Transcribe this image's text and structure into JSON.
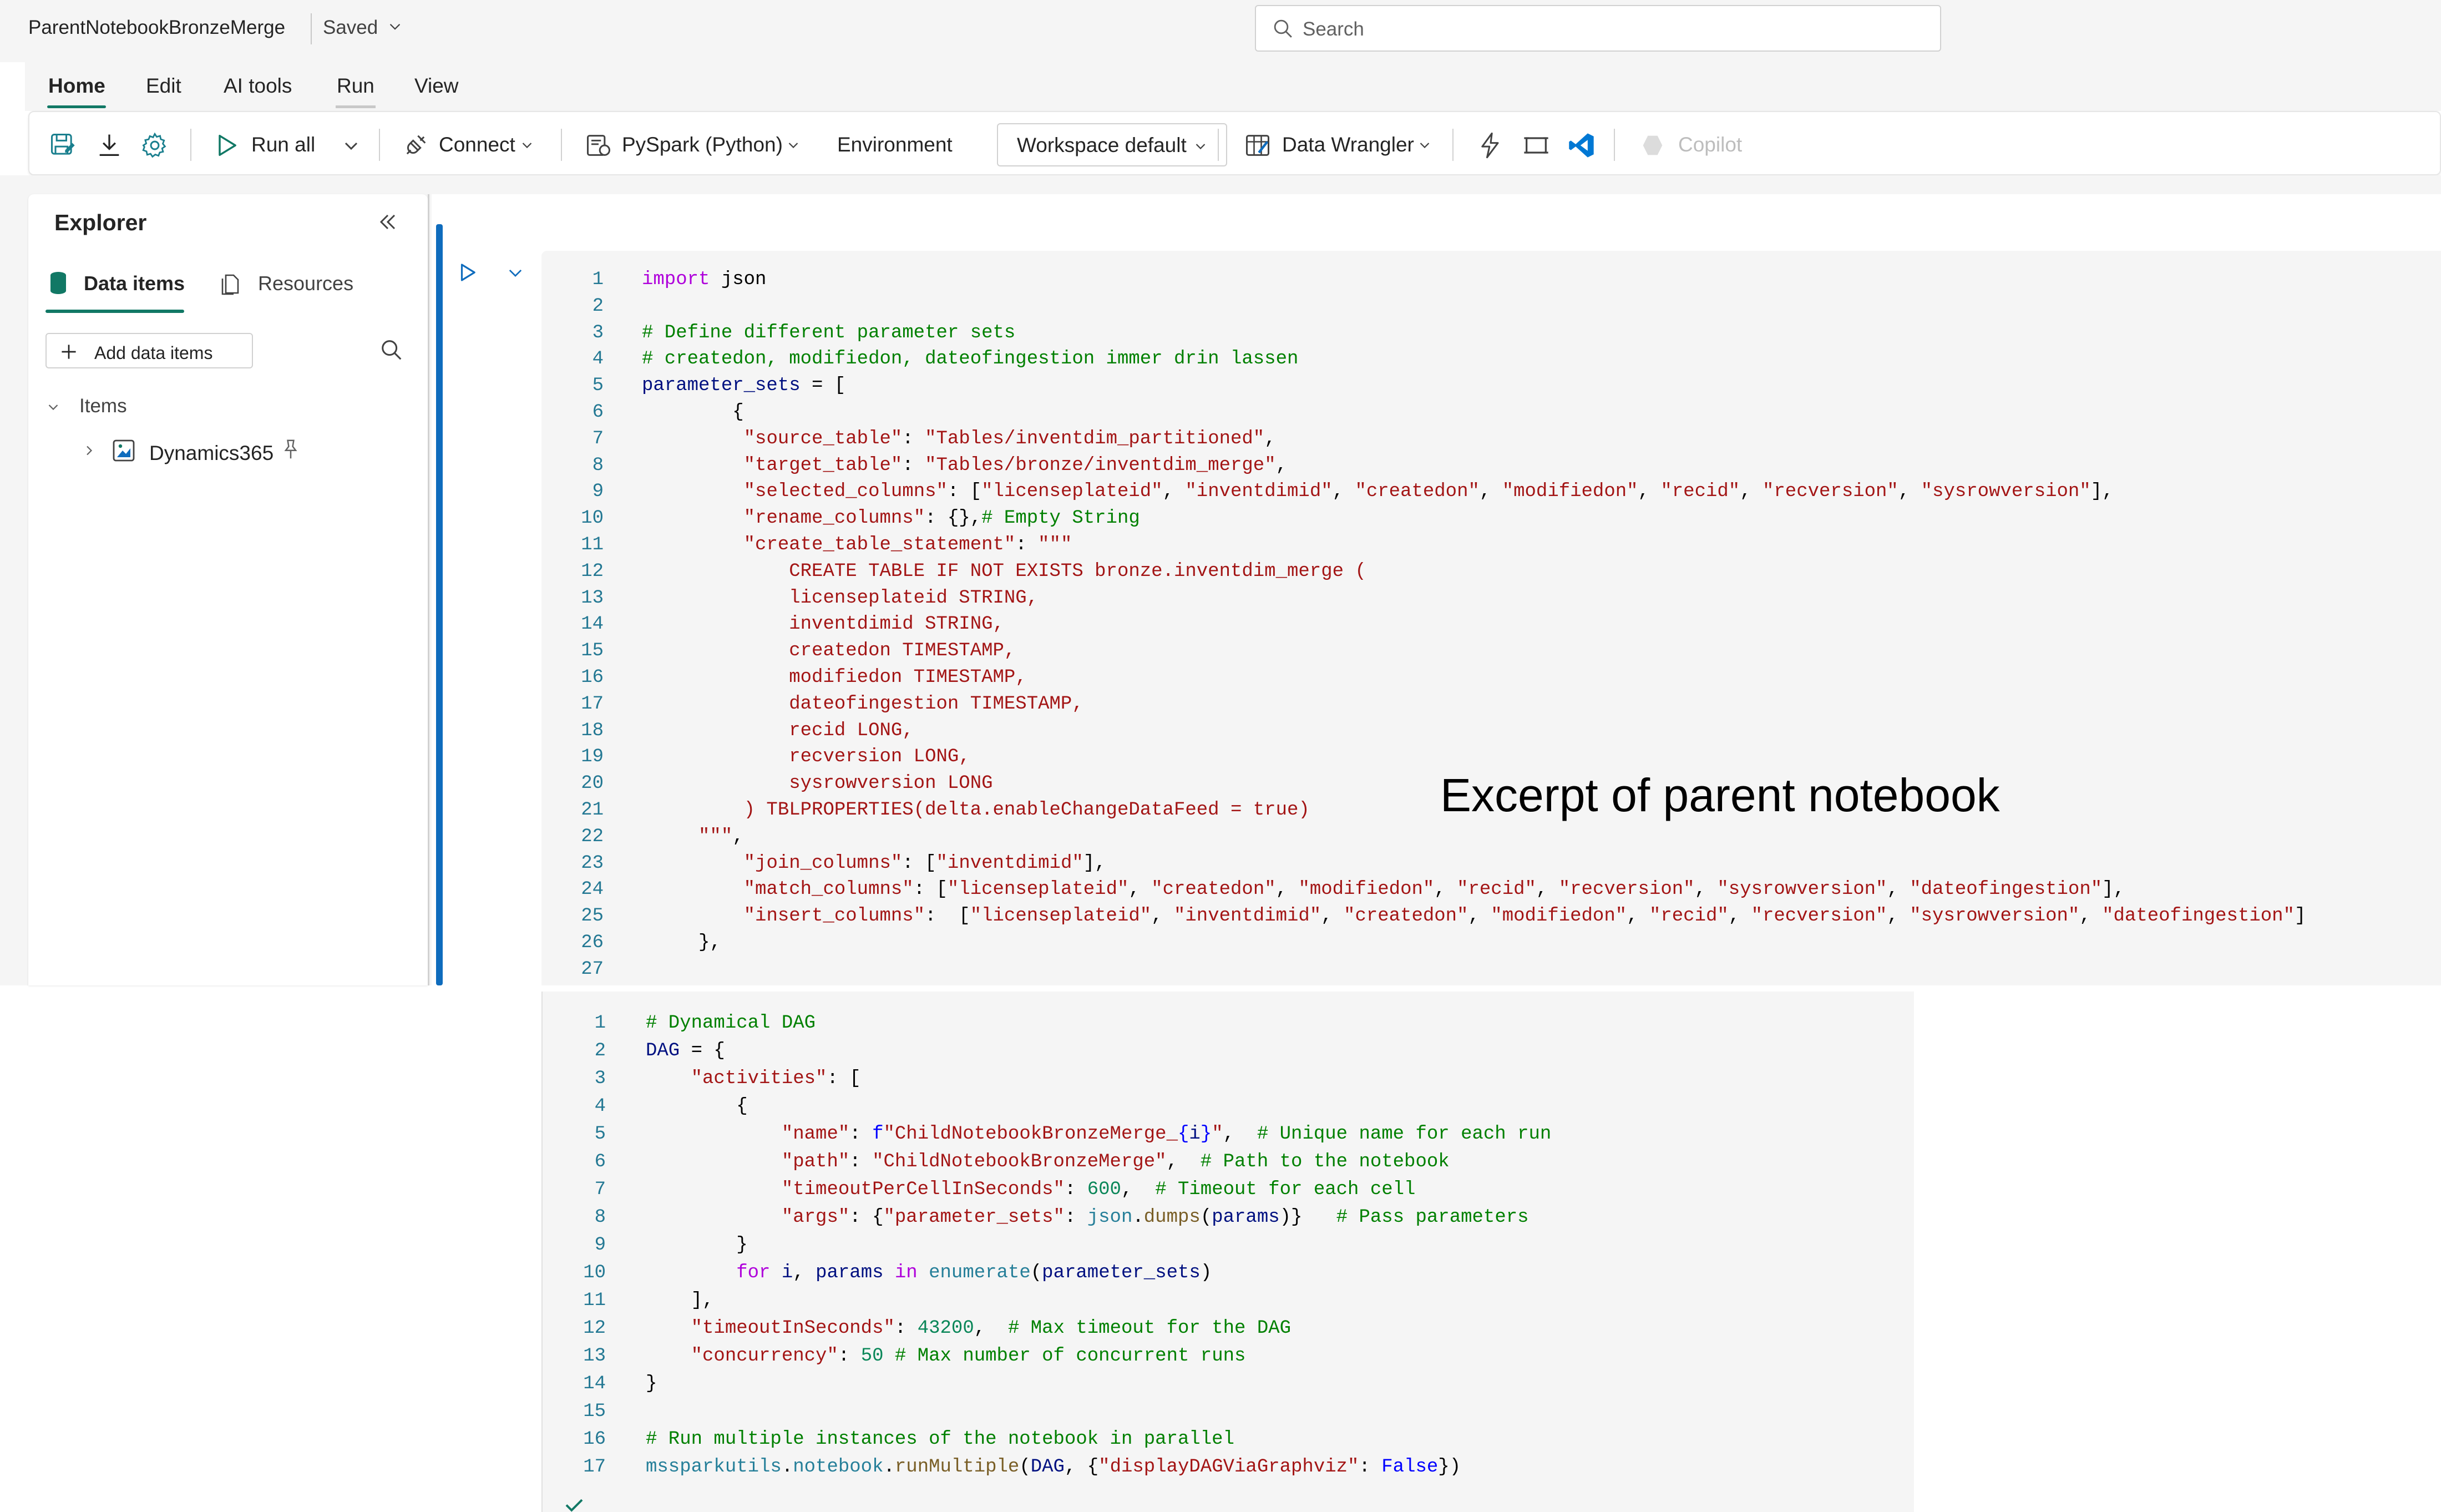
{
  "titlebar": {
    "notebook_name": "ParentNotebookBronzeMerge",
    "save_status": "Saved",
    "search_placeholder": "Search"
  },
  "menu": {
    "tabs": [
      {
        "label": "Home",
        "active": true
      },
      {
        "label": "Edit"
      },
      {
        "label": "AI tools"
      },
      {
        "label": "Run"
      },
      {
        "label": "View"
      }
    ]
  },
  "ribbon": {
    "run_all": "Run all",
    "connect": "Connect",
    "language": "PySpark (Python)",
    "environment_label": "Environment",
    "environment_value": "Workspace default",
    "data_wrangler": "Data Wrangler",
    "copilot": "Copilot"
  },
  "explorer": {
    "title": "Explorer",
    "tabs": [
      "Data items",
      "Resources"
    ],
    "add_button": "Add data items",
    "section": "Items",
    "items": [
      "Dynamics365"
    ]
  },
  "caption": "Excerpt of parent notebook",
  "colors": {
    "accent": "#117865",
    "cell_bar": "#0f6cbd",
    "keyword": "#af00db",
    "comment": "#008000",
    "string": "#a31515",
    "number": "#098658",
    "line_number": "#237893"
  },
  "cell1_code": [
    [
      [
        "kw",
        "import"
      ],
      [
        "tx",
        " json"
      ]
    ],
    [],
    [
      [
        "cm",
        "# Define different parameter sets"
      ]
    ],
    [
      [
        "cm",
        "# createdon, modifiedon, dateofingestion immer drin lassen"
      ]
    ],
    [
      [
        "va",
        "parameter_sets"
      ],
      [
        "tx",
        " = ["
      ]
    ],
    [
      [
        "tx",
        "        {"
      ]
    ],
    [
      [
        "tx",
        "         "
      ],
      [
        "st",
        "\"source_table\""
      ],
      [
        "tx",
        ": "
      ],
      [
        "st",
        "\"Tables/inventdim_partitioned\""
      ],
      [
        "tx",
        ","
      ]
    ],
    [
      [
        "tx",
        "         "
      ],
      [
        "st",
        "\"target_table\""
      ],
      [
        "tx",
        ": "
      ],
      [
        "st",
        "\"Tables/bronze/inventdim_merge\""
      ],
      [
        "tx",
        ","
      ]
    ],
    [
      [
        "tx",
        "         "
      ],
      [
        "st",
        "\"selected_columns\""
      ],
      [
        "tx",
        ": ["
      ],
      [
        "st",
        "\"licenseplateid\""
      ],
      [
        "tx",
        ", "
      ],
      [
        "st",
        "\"inventdimid\""
      ],
      [
        "tx",
        ", "
      ],
      [
        "st",
        "\"createdon\""
      ],
      [
        "tx",
        ", "
      ],
      [
        "st",
        "\"modifiedon\""
      ],
      [
        "tx",
        ", "
      ],
      [
        "st",
        "\"recid\""
      ],
      [
        "tx",
        ", "
      ],
      [
        "st",
        "\"recversion\""
      ],
      [
        "tx",
        ", "
      ],
      [
        "st",
        "\"sysrowversion\""
      ],
      [
        "tx",
        "],"
      ]
    ],
    [
      [
        "tx",
        "         "
      ],
      [
        "st",
        "\"rename_columns\""
      ],
      [
        "tx",
        ": {},"
      ],
      [
        "cm",
        "# Empty String"
      ]
    ],
    [
      [
        "tx",
        "         "
      ],
      [
        "st",
        "\"create_table_statement\""
      ],
      [
        "tx",
        ": "
      ],
      [
        "st",
        "\"\"\""
      ]
    ],
    [
      [
        "st",
        "             CREATE TABLE IF NOT EXISTS bronze.inventdim_merge ("
      ]
    ],
    [
      [
        "st",
        "             licenseplateid STRING,"
      ]
    ],
    [
      [
        "st",
        "             inventdimid STRING,"
      ]
    ],
    [
      [
        "st",
        "             createdon TIMESTAMP,"
      ]
    ],
    [
      [
        "st",
        "             modifiedon TIMESTAMP,"
      ]
    ],
    [
      [
        "st",
        "             dateofingestion TIMESTAMP,"
      ]
    ],
    [
      [
        "st",
        "             recid LONG,"
      ]
    ],
    [
      [
        "st",
        "             recversion LONG,"
      ]
    ],
    [
      [
        "st",
        "             sysrowversion LONG"
      ]
    ],
    [
      [
        "st",
        "         ) TBLPROPERTIES(delta.enableChangeDataFeed = true)"
      ]
    ],
    [
      [
        "st",
        "     \"\"\""
      ],
      [
        "tx",
        ","
      ]
    ],
    [
      [
        "tx",
        "         "
      ],
      [
        "st",
        "\"join_columns\""
      ],
      [
        "tx",
        ": ["
      ],
      [
        "st",
        "\"inventdimid\""
      ],
      [
        "tx",
        "],"
      ]
    ],
    [
      [
        "tx",
        "         "
      ],
      [
        "st",
        "\"match_columns\""
      ],
      [
        "tx",
        ": ["
      ],
      [
        "st",
        "\"licenseplateid\""
      ],
      [
        "tx",
        ", "
      ],
      [
        "st",
        "\"createdon\""
      ],
      [
        "tx",
        ", "
      ],
      [
        "st",
        "\"modifiedon\""
      ],
      [
        "tx",
        ", "
      ],
      [
        "st",
        "\"recid\""
      ],
      [
        "tx",
        ", "
      ],
      [
        "st",
        "\"recversion\""
      ],
      [
        "tx",
        ", "
      ],
      [
        "st",
        "\"sysrowversion\""
      ],
      [
        "tx",
        ", "
      ],
      [
        "st",
        "\"dateofingestion\""
      ],
      [
        "tx",
        "],"
      ]
    ],
    [
      [
        "tx",
        "         "
      ],
      [
        "st",
        "\"insert_columns\""
      ],
      [
        "tx",
        ":  ["
      ],
      [
        "st",
        "\"licenseplateid\""
      ],
      [
        "tx",
        ", "
      ],
      [
        "st",
        "\"inventdimid\""
      ],
      [
        "tx",
        ", "
      ],
      [
        "st",
        "\"createdon\""
      ],
      [
        "tx",
        ", "
      ],
      [
        "st",
        "\"modifiedon\""
      ],
      [
        "tx",
        ", "
      ],
      [
        "st",
        "\"recid\""
      ],
      [
        "tx",
        ", "
      ],
      [
        "st",
        "\"recversion\""
      ],
      [
        "tx",
        ", "
      ],
      [
        "st",
        "\"sysrowversion\""
      ],
      [
        "tx",
        ", "
      ],
      [
        "st",
        "\"dateofingestion\""
      ],
      [
        "tx",
        "]"
      ]
    ],
    [
      [
        "tx",
        "     },"
      ]
    ],
    []
  ],
  "cell2_code": [
    [
      [
        "cm",
        "# Dynamical DAG"
      ]
    ],
    [
      [
        "va",
        "DAG"
      ],
      [
        "tx",
        " = {"
      ]
    ],
    [
      [
        "tx",
        "    "
      ],
      [
        "st",
        "\"activities\""
      ],
      [
        "tx",
        ": ["
      ]
    ],
    [
      [
        "tx",
        "        {"
      ]
    ],
    [
      [
        "tx",
        "            "
      ],
      [
        "st",
        "\"name\""
      ],
      [
        "tx",
        ": "
      ],
      [
        "bu",
        "f"
      ],
      [
        "st",
        "\"ChildNotebookBronzeMerge_"
      ],
      [
        "bu",
        "{"
      ],
      [
        "va",
        "i"
      ],
      [
        "bu",
        "}"
      ],
      [
        "st",
        "\""
      ],
      [
        "tx",
        ",  "
      ],
      [
        "cm",
        "# Unique name for each run"
      ]
    ],
    [
      [
        "tx",
        "            "
      ],
      [
        "st",
        "\"path\""
      ],
      [
        "tx",
        ": "
      ],
      [
        "st",
        "\"ChildNotebookBronzeMerge\""
      ],
      [
        "tx",
        ",  "
      ],
      [
        "cm",
        "# Path to the notebook"
      ]
    ],
    [
      [
        "tx",
        "            "
      ],
      [
        "st",
        "\"timeoutPerCellInSeconds\""
      ],
      [
        "tx",
        ": "
      ],
      [
        "nu",
        "600"
      ],
      [
        "tx",
        ",  "
      ],
      [
        "cm",
        "# Timeout for each cell"
      ]
    ],
    [
      [
        "tx",
        "            "
      ],
      [
        "st",
        "\"args\""
      ],
      [
        "tx",
        ": {"
      ],
      [
        "st",
        "\"parameter_sets\""
      ],
      [
        "tx",
        ": "
      ],
      [
        "md",
        "json"
      ],
      [
        "tx",
        "."
      ],
      [
        "fn",
        "dumps"
      ],
      [
        "tx",
        "("
      ],
      [
        "va",
        "params"
      ],
      [
        "tx",
        ")}   "
      ],
      [
        "cm",
        "# Pass parameters"
      ]
    ],
    [
      [
        "tx",
        "        }"
      ]
    ],
    [
      [
        "tx",
        "        "
      ],
      [
        "kw",
        "for"
      ],
      [
        "tx",
        " "
      ],
      [
        "va",
        "i"
      ],
      [
        "tx",
        ", "
      ],
      [
        "va",
        "params"
      ],
      [
        "tx",
        " "
      ],
      [
        "kw",
        "in"
      ],
      [
        "tx",
        " "
      ],
      [
        "md",
        "enumerate"
      ],
      [
        "tx",
        "("
      ],
      [
        "va",
        "parameter_sets"
      ],
      [
        "tx",
        ")"
      ]
    ],
    [
      [
        "tx",
        "    ],"
      ]
    ],
    [
      [
        "tx",
        "    "
      ],
      [
        "st",
        "\"timeoutInSeconds\""
      ],
      [
        "tx",
        ": "
      ],
      [
        "nu",
        "43200"
      ],
      [
        "tx",
        ",  "
      ],
      [
        "cm",
        "# Max timeout for the DAG"
      ]
    ],
    [
      [
        "tx",
        "    "
      ],
      [
        "st",
        "\"concurrency\""
      ],
      [
        "tx",
        ": "
      ],
      [
        "nu",
        "50"
      ],
      [
        "tx",
        " "
      ],
      [
        "cm",
        "# Max number of concurrent runs"
      ]
    ],
    [
      [
        "tx",
        "}"
      ]
    ],
    [],
    [
      [
        "cm",
        "# Run multiple instances of the notebook in parallel"
      ]
    ],
    [
      [
        "md",
        "mssparkutils"
      ],
      [
        "tx",
        "."
      ],
      [
        "md",
        "notebook"
      ],
      [
        "tx",
        "."
      ],
      [
        "fn",
        "runMultiple"
      ],
      [
        "tx",
        "("
      ],
      [
        "va",
        "DAG"
      ],
      [
        "tx",
        ", {"
      ],
      [
        "st",
        "\"displayDAGViaGraphviz\""
      ],
      [
        "tx",
        ": "
      ],
      [
        "bu",
        "False"
      ],
      [
        "tx",
        "})"
      ]
    ]
  ]
}
